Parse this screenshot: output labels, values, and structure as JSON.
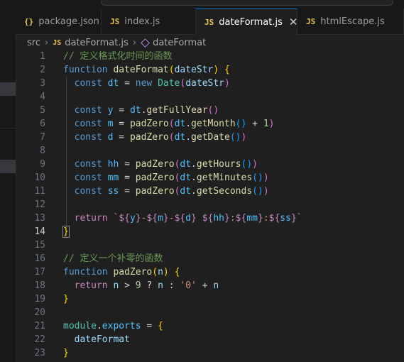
{
  "tabs": [
    {
      "icon": "{}",
      "label": "package.json",
      "active": false
    },
    {
      "icon": "JS",
      "label": "index.js",
      "active": false
    },
    {
      "icon": "JS",
      "label": "dateFormat.js",
      "active": true,
      "close": "✕"
    },
    {
      "icon": "JS",
      "label": "htmlEscape.js",
      "active": false
    }
  ],
  "breadcrumb": {
    "folder": "src",
    "sep": "›",
    "file_icon": "JS",
    "file": "dateFormat.js",
    "symbol": "dateFormat"
  },
  "editor": {
    "current_line": 14,
    "lines": [
      {
        "n": "1",
        "t": [
          [
            "comment",
            "// 定义格式化时间的函数"
          ]
        ]
      },
      {
        "n": "2",
        "t": [
          [
            "kw",
            "function"
          ],
          [
            "plain",
            " "
          ],
          [
            "fn",
            "dateFormat"
          ],
          [
            "b1",
            "("
          ],
          [
            "param",
            "dateStr"
          ],
          [
            "b1",
            ")"
          ],
          [
            "plain",
            " "
          ],
          [
            "b1",
            "{"
          ]
        ]
      },
      {
        "n": "3",
        "t": [
          [
            "plain",
            "  "
          ],
          [
            "kw",
            "const"
          ],
          [
            "plain",
            " "
          ],
          [
            "var",
            "dt"
          ],
          [
            "plain",
            " = "
          ],
          [
            "kw",
            "new"
          ],
          [
            "plain",
            " "
          ],
          [
            "cls",
            "Date"
          ],
          [
            "b2",
            "("
          ],
          [
            "param",
            "dateStr"
          ],
          [
            "b2",
            ")"
          ]
        ]
      },
      {
        "n": "4",
        "t": []
      },
      {
        "n": "5",
        "t": [
          [
            "plain",
            "  "
          ],
          [
            "kw",
            "const"
          ],
          [
            "plain",
            " "
          ],
          [
            "var",
            "y"
          ],
          [
            "plain",
            " = "
          ],
          [
            "var",
            "dt"
          ],
          [
            "plain",
            "."
          ],
          [
            "fn",
            "getFullYear"
          ],
          [
            "b2",
            "()"
          ]
        ]
      },
      {
        "n": "6",
        "t": [
          [
            "plain",
            "  "
          ],
          [
            "kw",
            "const"
          ],
          [
            "plain",
            " "
          ],
          [
            "var",
            "m"
          ],
          [
            "plain",
            " = "
          ],
          [
            "fn",
            "padZero"
          ],
          [
            "b2",
            "("
          ],
          [
            "var",
            "dt"
          ],
          [
            "plain",
            "."
          ],
          [
            "fn",
            "getMonth"
          ],
          [
            "b3",
            "()"
          ],
          [
            "plain",
            " + "
          ],
          [
            "num",
            "1"
          ],
          [
            "b2",
            ")"
          ]
        ]
      },
      {
        "n": "7",
        "t": [
          [
            "plain",
            "  "
          ],
          [
            "kw",
            "const"
          ],
          [
            "plain",
            " "
          ],
          [
            "var",
            "d"
          ],
          [
            "plain",
            " = "
          ],
          [
            "fn",
            "padZero"
          ],
          [
            "b2",
            "("
          ],
          [
            "var",
            "dt"
          ],
          [
            "plain",
            "."
          ],
          [
            "fn",
            "getDate"
          ],
          [
            "b3",
            "()"
          ],
          [
            "b2",
            ")"
          ]
        ]
      },
      {
        "n": "8",
        "t": []
      },
      {
        "n": "9",
        "t": [
          [
            "plain",
            "  "
          ],
          [
            "kw",
            "const"
          ],
          [
            "plain",
            " "
          ],
          [
            "var",
            "hh"
          ],
          [
            "plain",
            " = "
          ],
          [
            "fn",
            "padZero"
          ],
          [
            "b2",
            "("
          ],
          [
            "var",
            "dt"
          ],
          [
            "plain",
            "."
          ],
          [
            "fn",
            "getHours"
          ],
          [
            "b3",
            "()"
          ],
          [
            "b2",
            ")"
          ]
        ]
      },
      {
        "n": "10",
        "t": [
          [
            "plain",
            "  "
          ],
          [
            "kw",
            "const"
          ],
          [
            "plain",
            " "
          ],
          [
            "var",
            "mm"
          ],
          [
            "plain",
            " = "
          ],
          [
            "fn",
            "padZero"
          ],
          [
            "b2",
            "("
          ],
          [
            "var",
            "dt"
          ],
          [
            "plain",
            "."
          ],
          [
            "fn",
            "getMinutes"
          ],
          [
            "b3",
            "()"
          ],
          [
            "b2",
            ")"
          ]
        ]
      },
      {
        "n": "11",
        "t": [
          [
            "plain",
            "  "
          ],
          [
            "kw",
            "const"
          ],
          [
            "plain",
            " "
          ],
          [
            "var",
            "ss"
          ],
          [
            "plain",
            " = "
          ],
          [
            "fn",
            "padZero"
          ],
          [
            "b2",
            "("
          ],
          [
            "var",
            "dt"
          ],
          [
            "plain",
            "."
          ],
          [
            "fn",
            "getSeconds"
          ],
          [
            "b3",
            "()"
          ],
          [
            "b2",
            ")"
          ]
        ]
      },
      {
        "n": "12",
        "t": []
      },
      {
        "n": "13",
        "t": [
          [
            "plain",
            "  "
          ],
          [
            "ctrl",
            "return"
          ],
          [
            "plain",
            " "
          ],
          [
            "str",
            "`"
          ],
          [
            "ctrl",
            "${"
          ],
          [
            "var",
            "y"
          ],
          [
            "ctrl",
            "}"
          ],
          [
            "str",
            "-"
          ],
          [
            "ctrl",
            "${"
          ],
          [
            "var",
            "m"
          ],
          [
            "ctrl",
            "}"
          ],
          [
            "str",
            "-"
          ],
          [
            "ctrl",
            "${"
          ],
          [
            "var",
            "d"
          ],
          [
            "ctrl",
            "}"
          ],
          [
            "str",
            " "
          ],
          [
            "ctrl",
            "${"
          ],
          [
            "var",
            "hh"
          ],
          [
            "ctrl",
            "}"
          ],
          [
            "str",
            ":"
          ],
          [
            "ctrl",
            "${"
          ],
          [
            "var",
            "mm"
          ],
          [
            "ctrl",
            "}"
          ],
          [
            "str",
            ":"
          ],
          [
            "ctrl",
            "${"
          ],
          [
            "var",
            "ss"
          ],
          [
            "ctrl",
            "}"
          ],
          [
            "str",
            "`"
          ]
        ]
      },
      {
        "n": "14",
        "t": [
          [
            "b1m",
            "}"
          ]
        ]
      },
      {
        "n": "15",
        "t": []
      },
      {
        "n": "16",
        "t": [
          [
            "comment",
            "// 定义一个补零的函数"
          ]
        ]
      },
      {
        "n": "17",
        "t": [
          [
            "kw",
            "function"
          ],
          [
            "plain",
            " "
          ],
          [
            "fn",
            "padZero"
          ],
          [
            "b1",
            "("
          ],
          [
            "param",
            "n"
          ],
          [
            "b1",
            ")"
          ],
          [
            "plain",
            " "
          ],
          [
            "b1",
            "{"
          ]
        ]
      },
      {
        "n": "18",
        "t": [
          [
            "plain",
            "  "
          ],
          [
            "ctrl",
            "return"
          ],
          [
            "plain",
            " "
          ],
          [
            "param",
            "n"
          ],
          [
            "plain",
            " > "
          ],
          [
            "num",
            "9"
          ],
          [
            "plain",
            " ? "
          ],
          [
            "param",
            "n"
          ],
          [
            "plain",
            " : "
          ],
          [
            "str",
            "'0'"
          ],
          [
            "plain",
            " + "
          ],
          [
            "param",
            "n"
          ]
        ]
      },
      {
        "n": "19",
        "t": [
          [
            "b1",
            "}"
          ]
        ]
      },
      {
        "n": "20",
        "t": []
      },
      {
        "n": "21",
        "t": [
          [
            "cls",
            "module"
          ],
          [
            "plain",
            "."
          ],
          [
            "var",
            "exports"
          ],
          [
            "plain",
            " = "
          ],
          [
            "b1",
            "{"
          ]
        ]
      },
      {
        "n": "22",
        "t": [
          [
            "plain",
            "  "
          ],
          [
            "prop",
            "dateFormat"
          ]
        ]
      },
      {
        "n": "23",
        "t": [
          [
            "b1",
            "}"
          ]
        ]
      }
    ]
  }
}
